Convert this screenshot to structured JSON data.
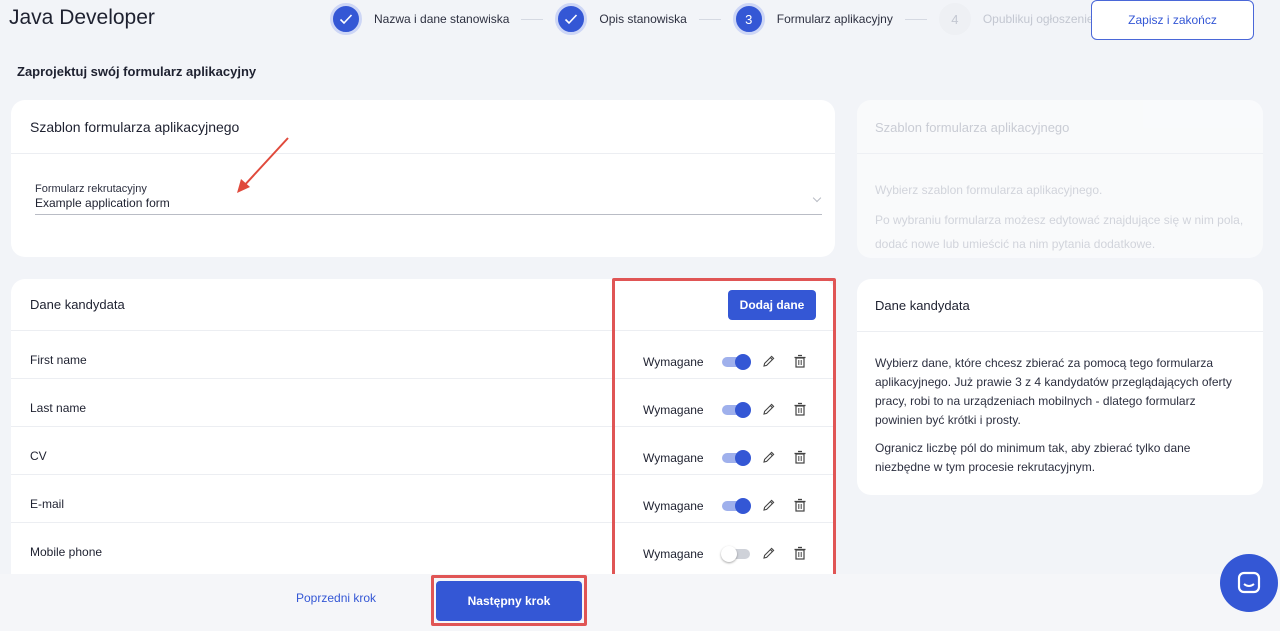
{
  "header": {
    "title": "Java Developer",
    "save_label": "Zapisz i zakończ"
  },
  "stepper": {
    "steps": [
      {
        "number": "",
        "label": "Nazwa i dane stanowiska",
        "state": "done"
      },
      {
        "number": "",
        "label": "Opis stanowiska",
        "state": "done"
      },
      {
        "number": "3",
        "label": "Formularz aplikacyjny",
        "state": "active"
      },
      {
        "number": "4",
        "label": "Opublikuj ogłoszenie",
        "state": "pending"
      }
    ]
  },
  "page": {
    "subtitle": "Zaprojektuj swój formularz aplikacyjny"
  },
  "template_card": {
    "title": "Szablon formularza aplikacyjnego",
    "field_label": "Formularz rekrutacyjny",
    "field_value": "Example application form"
  },
  "template_help": {
    "title": "Szablon formularza aplikacyjnego",
    "line1": "Wybierz szablon formularza aplikacyjnego.",
    "line2": "Po wybraniu formularza możesz edytować znajdujące się w nim pola, dodać nowe lub umieścić na nim pytania dodatkowe."
  },
  "candidate_data": {
    "title": "Dane kandydata",
    "add_label": "Dodaj dane",
    "rows": [
      {
        "label": "First name",
        "required_label": "Wymagane",
        "required": true
      },
      {
        "label": "Last name",
        "required_label": "Wymagane",
        "required": true
      },
      {
        "label": "CV",
        "required_label": "Wymagane",
        "required": true
      },
      {
        "label": "E-mail",
        "required_label": "Wymagane",
        "required": true
      },
      {
        "label": "Mobile phone",
        "required_label": "Wymagane",
        "required": false
      }
    ]
  },
  "candidate_help": {
    "title": "Dane kandydata",
    "p1": "Wybierz dane, które chcesz zbierać za pomocą tego formularza aplikacyjnego. Już prawie 3 z 4 kandydatów przeglądających oferty pracy, robi to na urządzeniach mobilnych - dlatego formularz powinien być krótki i prosty.",
    "p2": "Ogranicz liczbę pól do minimum tak, aby zbierać tylko dane niezbędne w tym procesie rekrutacyjnym."
  },
  "footer": {
    "prev_label": "Poprzedni krok",
    "next_label": "Następny krok"
  },
  "colors": {
    "accent": "#3457d5",
    "highlight": "#e05555"
  }
}
